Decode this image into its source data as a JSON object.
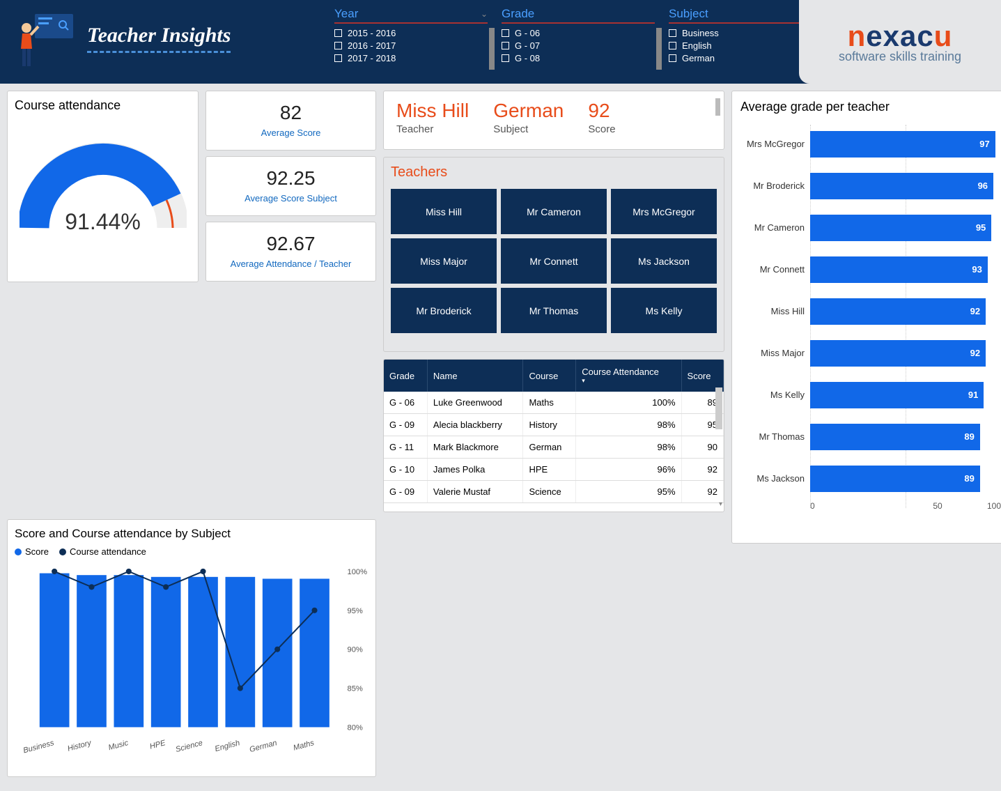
{
  "header": {
    "title": "Teacher Insights",
    "filters": {
      "year": {
        "label": "Year",
        "items": [
          "2015 - 2016",
          "2016 - 2017",
          "2017 - 2018"
        ]
      },
      "grade": {
        "label": "Grade",
        "items": [
          "G - 06",
          "G - 07",
          "G - 08"
        ]
      },
      "subject": {
        "label": "Subject",
        "items": [
          "Business",
          "English",
          "German"
        ]
      }
    },
    "logo": {
      "main": "nexacu",
      "sub": "software skills training"
    }
  },
  "attendance": {
    "title": "Course attendance",
    "value_text": "91.44%",
    "value": 91.44
  },
  "kpis": [
    {
      "value": "82",
      "label": "Average Score"
    },
    {
      "value": "92.25",
      "label": "Average Score Subject"
    },
    {
      "value": "92.67",
      "label": "Average Attendance / Teacher"
    }
  ],
  "selected": {
    "teacher": "Miss Hill",
    "teacher_label": "Teacher",
    "subject": "German",
    "subject_label": "Subject",
    "score": "92",
    "score_label": "Score"
  },
  "teachers_panel": {
    "title": "Teachers",
    "items": [
      "Miss Hill",
      "Mr Cameron",
      "Mrs McGregor",
      "Miss Major",
      "Mr Connett",
      "Ms Jackson",
      "Mr Broderick",
      "Mr Thomas",
      "Ms Kelly"
    ]
  },
  "table": {
    "headers": [
      "Grade",
      "Name",
      "Course",
      "Course Attendance",
      "Score"
    ],
    "rows": [
      {
        "grade": "G - 06",
        "name": "Luke Greenwood",
        "course": "Maths",
        "att": "100%",
        "score": "89"
      },
      {
        "grade": "G - 09",
        "name": "Alecia blackberry",
        "course": "History",
        "att": "98%",
        "score": "95"
      },
      {
        "grade": "G - 11",
        "name": "Mark Blackmore",
        "course": "German",
        "att": "98%",
        "score": "90"
      },
      {
        "grade": "G - 10",
        "name": "James Polka",
        "course": "HPE",
        "att": "96%",
        "score": "92"
      },
      {
        "grade": "G - 09",
        "name": "Valerie Mustaf",
        "course": "Science",
        "att": "95%",
        "score": "92"
      }
    ]
  },
  "chart_data": [
    {
      "type": "gauge",
      "title": "Course attendance",
      "value": 91.44,
      "min": 0,
      "max": 100
    },
    {
      "type": "bar-line-combo",
      "title": "Score and Course attendance by Subject",
      "categories": [
        "Business",
        "History",
        "Music",
        "HPE",
        "Science",
        "English",
        "German",
        "Maths"
      ],
      "series": [
        {
          "name": "Score",
          "type": "bar",
          "values": [
            84,
            83,
            83,
            82,
            82,
            82,
            81,
            81
          ]
        },
        {
          "name": "Course attendance",
          "type": "line",
          "values": [
            100,
            98,
            100,
            98,
            100,
            85,
            90,
            95
          ],
          "ylim": [
            80,
            100
          ]
        }
      ],
      "legend": [
        "Score",
        "Course attendance"
      ]
    },
    {
      "type": "bar",
      "title": "Average grade per teacher",
      "categories": [
        "Mrs McGregor",
        "Mr Broderick",
        "Mr Cameron",
        "Mr Connett",
        "Miss Hill",
        "Miss Major",
        "Ms Kelly",
        "Mr Thomas",
        "Ms Jackson"
      ],
      "values": [
        97,
        96,
        95,
        93,
        92,
        92,
        91,
        89,
        89
      ],
      "xlim": [
        0,
        100
      ],
      "xlabel": "",
      "ylabel": ""
    }
  ],
  "combo": {
    "title": "Score and Course attendance by Subject",
    "legend": {
      "score": "Score",
      "att": "Course attendance"
    },
    "y2_ticks": [
      "100%",
      "95%",
      "90%",
      "85%",
      "80%"
    ]
  },
  "bar_chart": {
    "title": "Average grade per teacher",
    "axis": [
      "0",
      "50",
      "100"
    ]
  }
}
